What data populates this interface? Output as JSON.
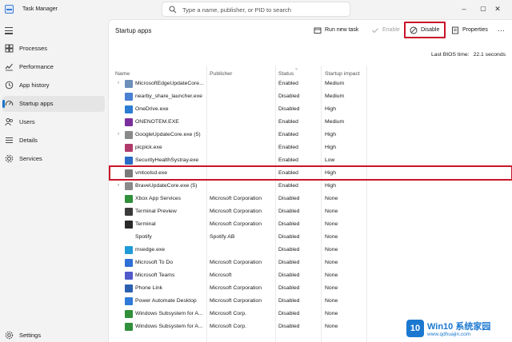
{
  "window": {
    "title": "Task Manager",
    "search_placeholder": "Type a name, publisher, or PID to search",
    "controls": [
      "–",
      "▢",
      "✕"
    ]
  },
  "sidebar": {
    "items": [
      {
        "label": "Processes",
        "icon": "processes-grid-icon",
        "active": false
      },
      {
        "label": "Performance",
        "icon": "performance-chart-icon",
        "active": false
      },
      {
        "label": "App history",
        "icon": "history-clock-icon",
        "active": false
      },
      {
        "label": "Startup apps",
        "icon": "startup-gauge-icon",
        "active": true
      },
      {
        "label": "Users",
        "icon": "users-icon",
        "active": false
      },
      {
        "label": "Details",
        "icon": "details-list-icon",
        "active": false
      },
      {
        "label": "Services",
        "icon": "services-puzzle-icon",
        "active": false
      }
    ],
    "settings_label": "Settings"
  },
  "toolbar": {
    "page_title": "Startup apps",
    "run_new_task": "Run new task",
    "enable": "Enable",
    "disable": "Disable",
    "properties": "Properties",
    "more": "···"
  },
  "bios": {
    "label": "Last BIOS time:",
    "value": "22.1 seconds"
  },
  "table": {
    "columns": [
      "Name",
      "Publisher",
      "Status",
      "Startup impact"
    ],
    "selected_row": 7,
    "rows": [
      {
        "name": "MicrosoftEdgeUpdateCore...",
        "publisher": "",
        "status": "Enabled",
        "impact": "Medium",
        "expandable": true,
        "icon": "edge-update-icon",
        "color": "#6d8fb8"
      },
      {
        "name": "nearby_share_launcher.exe",
        "publisher": "",
        "status": "Disabled",
        "impact": "Medium",
        "expandable": false,
        "icon": "nearby-share-icon",
        "color": "#4a7fd4"
      },
      {
        "name": "OneDrive.exe",
        "publisher": "",
        "status": "Disabled",
        "impact": "High",
        "expandable": false,
        "icon": "onedrive-cloud-icon",
        "color": "#2b7cd3"
      },
      {
        "name": "ONENOTEM.EXE",
        "publisher": "",
        "status": "Enabled",
        "impact": "Medium",
        "expandable": false,
        "icon": "onenote-icon",
        "color": "#7b2f9c"
      },
      {
        "name": "GoogleUpdateCore.exe (5)",
        "publisher": "",
        "status": "Enabled",
        "impact": "High",
        "expandable": true,
        "icon": "google-update-icon",
        "color": "#8a8a8a"
      },
      {
        "name": "picpick.exe",
        "publisher": "",
        "status": "Enabled",
        "impact": "High",
        "expandable": false,
        "icon": "picpick-icon",
        "color": "#b03a6a"
      },
      {
        "name": "SecurityHealthSystray.exe",
        "publisher": "",
        "status": "Enabled",
        "impact": "Low",
        "expandable": false,
        "icon": "security-shield-icon",
        "color": "#2a6bc4"
      },
      {
        "name": "vmtoolsd.exe",
        "publisher": "",
        "status": "Enabled",
        "impact": "High",
        "expandable": false,
        "icon": "vmware-tools-icon",
        "color": "#7a7a7a"
      },
      {
        "name": "BraveUpdateCore.exe (5)",
        "publisher": "",
        "status": "Enabled",
        "impact": "High",
        "expandable": true,
        "icon": "brave-update-icon",
        "color": "#8a8a8a"
      },
      {
        "name": "Xbox App Services",
        "publisher": "Microsoft Corporation",
        "status": "Disabled",
        "impact": "None",
        "expandable": false,
        "icon": "xbox-icon",
        "color": "#2f8f3a"
      },
      {
        "name": "Terminal Preview",
        "publisher": "Microsoft Corporation",
        "status": "Disabled",
        "impact": "None",
        "expandable": false,
        "icon": "terminal-preview-icon",
        "color": "#3a3a3a"
      },
      {
        "name": "Terminal",
        "publisher": "Microsoft Corporation",
        "status": "Disabled",
        "impact": "None",
        "expandable": false,
        "icon": "terminal-icon",
        "color": "#2a2a2a"
      },
      {
        "name": "Spotify",
        "publisher": "Spotify AB",
        "status": "Disabled",
        "impact": "None",
        "expandable": false,
        "icon": "",
        "color": ""
      },
      {
        "name": "msedge.exe",
        "publisher": "",
        "status": "Disabled",
        "impact": "None",
        "expandable": false,
        "icon": "edge-browser-icon",
        "color": "#1f9ad6"
      },
      {
        "name": "Microsoft To Do",
        "publisher": "Microsoft Corporation",
        "status": "Disabled",
        "impact": "None",
        "expandable": false,
        "icon": "todo-check-icon",
        "color": "#2f6fd6"
      },
      {
        "name": "Microsoft Teams",
        "publisher": "Microsoft",
        "status": "Disabled",
        "impact": "None",
        "expandable": false,
        "icon": "teams-icon",
        "color": "#5059c9"
      },
      {
        "name": "Phone Link",
        "publisher": "Microsoft Corporation",
        "status": "Disabled",
        "impact": "None",
        "expandable": false,
        "icon": "phone-link-icon",
        "color": "#2a5fb0"
      },
      {
        "name": "Power Automate Desktop",
        "publisher": "Microsoft Corporation",
        "status": "Disabled",
        "impact": "None",
        "expandable": false,
        "icon": "power-automate-icon",
        "color": "#2f7ad9"
      },
      {
        "name": "Windows Subsystem for A...",
        "publisher": "Microsoft Corp.",
        "status": "Disabled",
        "impact": "None",
        "expandable": false,
        "icon": "wsa-icon",
        "color": "#2f8f3a"
      },
      {
        "name": "Windows Subsystem for A...",
        "publisher": "Microsoft Corp.",
        "status": "Disabled",
        "impact": "None",
        "expandable": false,
        "icon": "wsa-icon",
        "color": "#2f8f3a"
      }
    ]
  },
  "watermark": {
    "logo": "10",
    "text": "Win10 系统家园",
    "url": "www.qdhuajin.com"
  },
  "colors": {
    "accent": "#1a73c9",
    "highlight": "#c8152a"
  }
}
